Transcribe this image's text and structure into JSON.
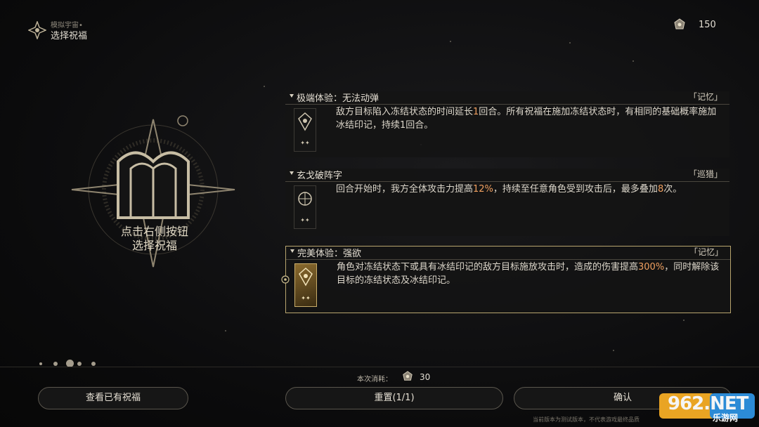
{
  "header": {
    "subtitle": "模拟宇宙•",
    "title": "选择祝福"
  },
  "currency": {
    "icon": "cosmic-fragment-icon",
    "value": "150"
  },
  "emblem": {
    "line1": "点击右侧按钮",
    "line2": "选择祝福"
  },
  "blessings": [
    {
      "title": "极端体验：无法动弹",
      "path": "「记忆」",
      "desc_parts": [
        "敌方目标陷入冻结状态的时间延长",
        "1",
        "回合。所有祝福在施加冻结状态时，有相同的基础概率施加冰结印记，持续1回合。"
      ],
      "stars": "✦✦",
      "selected": false
    },
    {
      "title": "玄戈破阵字",
      "path": "「巡猎」",
      "desc_parts": [
        "回合开始时，我方全体攻击力提高",
        "12%",
        "，持续至任意角色受到攻击后，最多叠加",
        "8",
        "次。"
      ],
      "stars": "✦✦",
      "selected": false
    },
    {
      "title": "完美体验：强欲",
      "path": "「记忆」",
      "desc_parts": [
        "角色对冻结状态下或具有冰结印记的敌方目标施放攻击时，造成的伤害提高",
        "300%",
        "，同时解除该目标的冻结状态及冰结印记。"
      ],
      "stars": "✦✦",
      "selected": true
    }
  ],
  "cost": {
    "label": "本次消耗：",
    "value": "30"
  },
  "buttons": {
    "view": "查看已有祝福",
    "reset": "重置(1/1)",
    "confirm": "确认"
  },
  "footer_note": "当前版本为测试版本，不代表游戏最终品质",
  "watermark": {
    "main": "962.NET",
    "sub": "乐游网"
  },
  "colors": {
    "highlight": "#f0a060",
    "selected_border": "#b8a56e"
  }
}
